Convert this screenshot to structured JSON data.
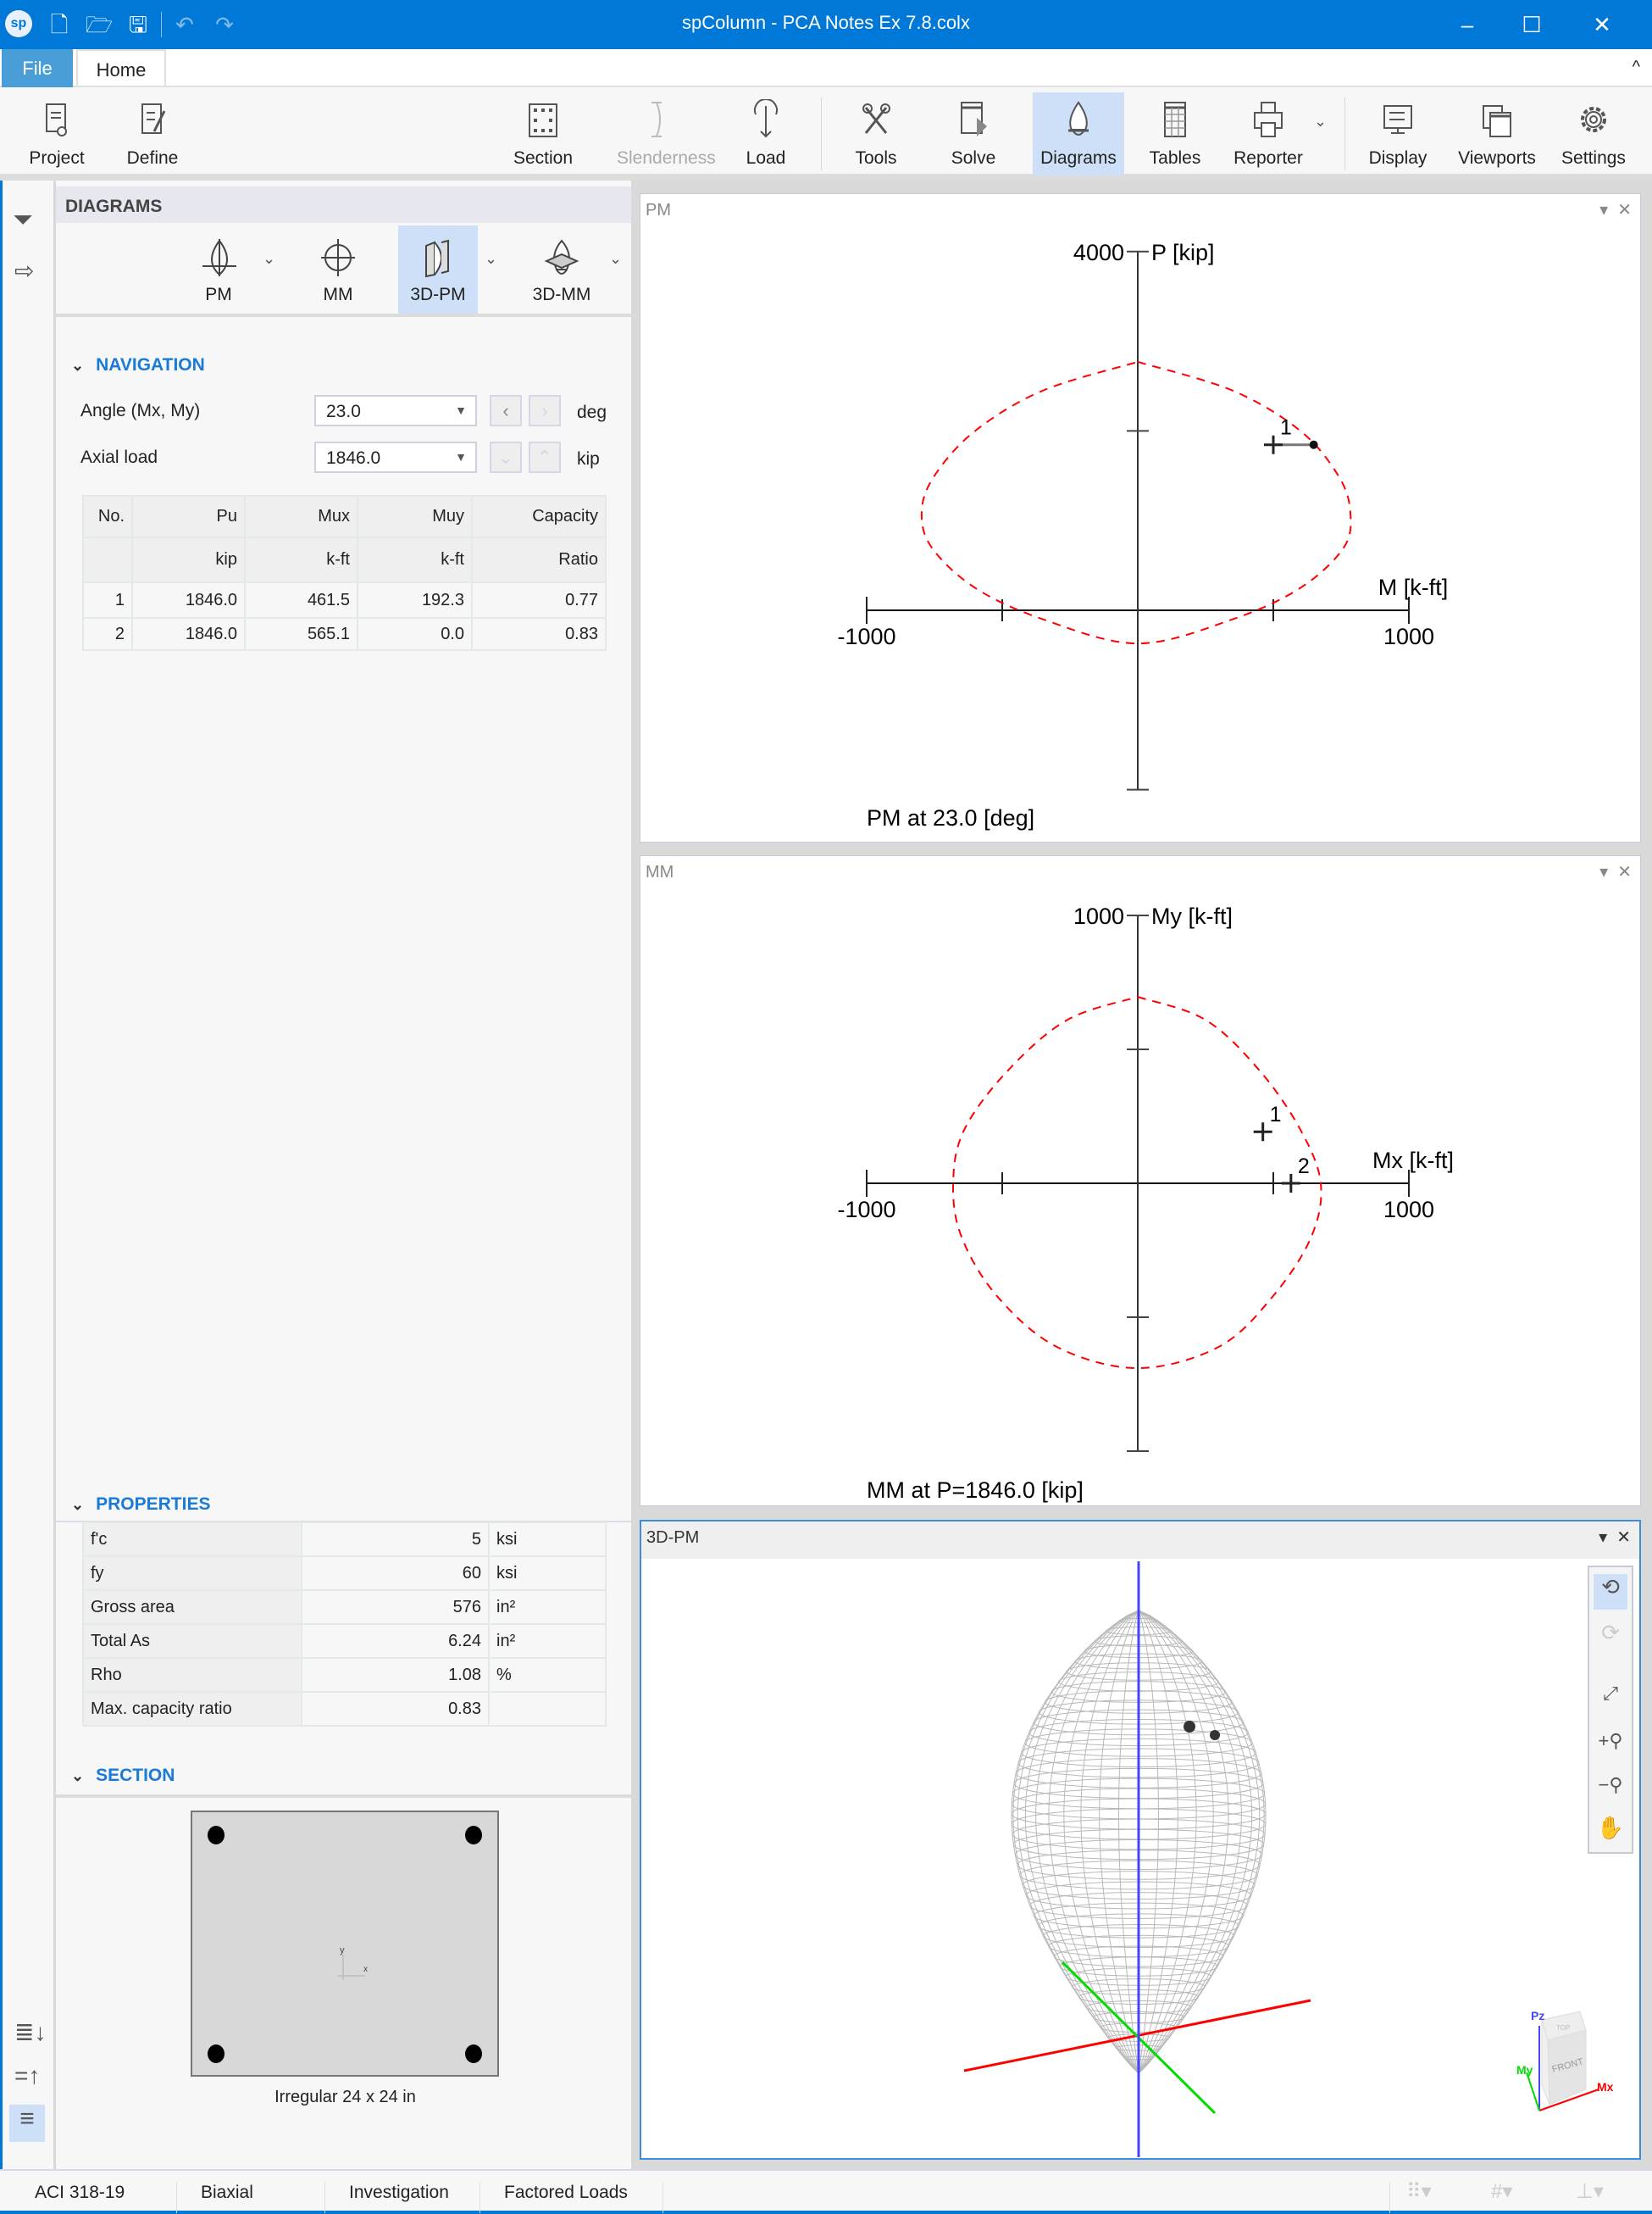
{
  "window": {
    "title": "spColumn - PCA Notes Ex 7.8.colx",
    "logo": "sp"
  },
  "quick_access": [
    "new-file-icon",
    "open-folder-icon",
    "save-icon",
    "undo-icon",
    "redo-icon"
  ],
  "tabs": [
    {
      "label": "File",
      "active": false
    },
    {
      "label": "Home",
      "active": true
    }
  ],
  "ribbon": {
    "buttons": [
      {
        "label": "Project",
        "icon": "project-icon"
      },
      {
        "label": "Define",
        "icon": "define-icon"
      },
      {
        "label": "Section",
        "icon": "section-icon"
      },
      {
        "label": "Slenderness",
        "icon": "slenderness-icon",
        "disabled": true
      },
      {
        "label": "Load",
        "icon": "load-icon"
      },
      {
        "label": "Tools",
        "icon": "tools-icon"
      },
      {
        "label": "Solve",
        "icon": "solve-icon"
      },
      {
        "label": "Diagrams",
        "icon": "diagrams-icon",
        "selected": true
      },
      {
        "label": "Tables",
        "icon": "tables-icon"
      },
      {
        "label": "Reporter",
        "icon": "printer-icon"
      },
      {
        "label": "Display",
        "icon": "display-icon"
      },
      {
        "label": "Viewports",
        "icon": "viewports-icon"
      },
      {
        "label": "Settings",
        "icon": "gear-icon"
      }
    ]
  },
  "diagrams": {
    "header": "DIAGRAMS",
    "buttons": [
      {
        "label": "PM"
      },
      {
        "label": "MM"
      },
      {
        "label": "3D-PM",
        "selected": true
      },
      {
        "label": "3D-MM"
      }
    ]
  },
  "navigation": {
    "header": "NAVIGATION",
    "angle": {
      "label": "Angle (Mx, My)",
      "value": "23.0",
      "unit": "deg"
    },
    "axial": {
      "label": "Axial load",
      "value": "1846.0",
      "unit": "kip"
    },
    "table": {
      "headers": [
        "No.",
        "Pu",
        "Mux",
        "Muy",
        "Capacity"
      ],
      "units": [
        "",
        "kip",
        "k-ft",
        "k-ft",
        "Ratio"
      ],
      "rows": [
        [
          "1",
          "1846.0",
          "461.5",
          "192.3",
          "0.77"
        ],
        [
          "2",
          "1846.0",
          "565.1",
          "0.0",
          "0.83"
        ]
      ]
    }
  },
  "properties": {
    "header": "PROPERTIES",
    "rows": [
      {
        "name": "f'c",
        "value": "5",
        "unit": "ksi"
      },
      {
        "name": "fy",
        "value": "60",
        "unit": "ksi"
      },
      {
        "name": "Gross area",
        "value": "576",
        "unit": "in²"
      },
      {
        "name": "Total As",
        "value": "6.24",
        "unit": "in²"
      },
      {
        "name": "Rho",
        "value": "1.08",
        "unit": "%"
      },
      {
        "name": "Max. capacity ratio",
        "value": "0.83",
        "unit": ""
      }
    ]
  },
  "section": {
    "header": "SECTION",
    "caption": "Irregular 24 x 24 in",
    "axis_x": "x",
    "axis_y": "y"
  },
  "panels": {
    "pm": "PM",
    "mm": "MM",
    "pm3d": "3D-PM"
  },
  "chart_data": [
    {
      "type": "line",
      "panel": "PM",
      "title": "PM at 23.0 [deg]",
      "xlabel": "M [k-ft]",
      "ylabel": "P [kip]",
      "xlim": [
        -1000,
        1000
      ],
      "ylim": [
        -2000,
        4000
      ],
      "x_tick_labels": [
        "-1000",
        "1000"
      ],
      "y_tick_label": "4000",
      "x_ticks": [
        -1000,
        -500,
        500,
        1000
      ],
      "y_ticks": [
        -2000,
        2000,
        4000
      ],
      "line_color": "#ff0000",
      "line_style": "dashed",
      "curve": [
        [
          0,
          2770
        ],
        [
          350,
          2450
        ],
        [
          600,
          2000
        ],
        [
          740,
          1500
        ],
        [
          784,
          1100
        ],
        [
          760,
          700
        ],
        [
          600,
          250
        ],
        [
          350,
          -100
        ],
        [
          0,
          -370
        ],
        [
          -350,
          -100
        ],
        [
          -600,
          250
        ],
        [
          -760,
          700
        ],
        [
          -797,
          1100
        ],
        [
          -750,
          1500
        ],
        [
          -600,
          2000
        ],
        [
          -350,
          2450
        ],
        [
          0,
          2770
        ]
      ],
      "points": [
        {
          "label": "1",
          "M": 500,
          "P": 1846.0,
          "capacity_M": 649
        }
      ]
    },
    {
      "type": "line",
      "panel": "MM",
      "title": "MM at P=1846.0 [kip]",
      "xlabel": "Mx [k-ft]",
      "ylabel": "My [k-ft]",
      "xlim": [
        -1000,
        1000
      ],
      "ylim": [
        -1000,
        1000
      ],
      "x_tick_labels": [
        "-1000",
        "1000"
      ],
      "y_tick_label": "1000",
      "x_ticks": [
        -1000,
        -500,
        500,
        1000
      ],
      "y_ticks": [
        -1000,
        -500,
        500,
        1000
      ],
      "line_color": "#ff0000",
      "line_style": "dashed",
      "curve": [
        [
          0,
          696
        ],
        [
          250,
          610
        ],
        [
          450,
          420
        ],
        [
          600,
          200
        ],
        [
          675,
          0
        ],
        [
          640,
          -200
        ],
        [
          500,
          -420
        ],
        [
          300,
          -610
        ],
        [
          0,
          -690
        ],
        [
          -300,
          -610
        ],
        [
          -520,
          -420
        ],
        [
          -650,
          -200
        ],
        [
          -681,
          0
        ],
        [
          -640,
          200
        ],
        [
          -480,
          420
        ],
        [
          -260,
          610
        ],
        [
          0,
          696
        ]
      ],
      "points": [
        {
          "label": "1",
          "Mx": 461.5,
          "My": 192.3
        },
        {
          "label": "2",
          "Mx": 565.1,
          "My": 0.0
        }
      ]
    }
  ],
  "view3d": {
    "toolbar": [
      "rotate-icon",
      "rotate-disabled-icon",
      "zoom-fit-icon",
      "zoom-in-icon",
      "zoom-out-icon",
      "pan-hand-icon"
    ],
    "cube": {
      "z": "Pz",
      "y": "My",
      "x": "Mx",
      "face": "FRONT",
      "top": "TOP"
    },
    "colors": {
      "x_axis": "#ff0000",
      "y_axis": "#00dd00",
      "z_axis": "#4444ff",
      "mesh": "#b8b8b8"
    }
  },
  "statusbar": {
    "items": [
      "ACI 318-19",
      "Biaxial",
      "Investigation",
      "Factored Loads"
    ]
  },
  "colors": {
    "accent": "#0078d7",
    "selected": "#cde0f7",
    "section_header": "#1a7bd6"
  }
}
